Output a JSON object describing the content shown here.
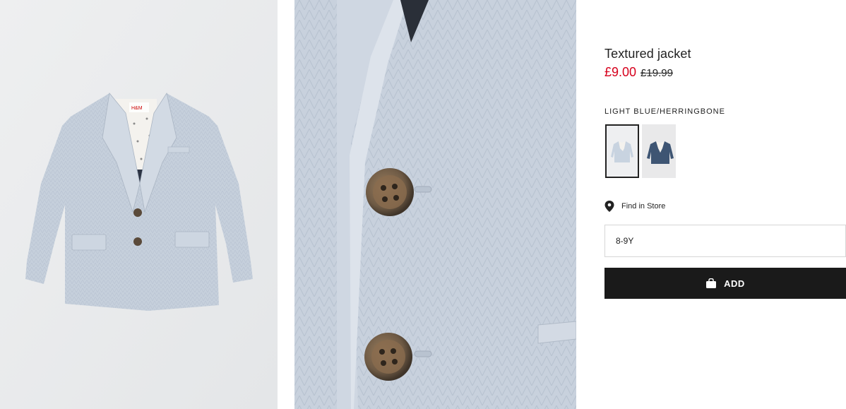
{
  "product": {
    "title": "Textured jacket",
    "price_sale": "£9.00",
    "price_original": "£19.99",
    "color_label": "LIGHT BLUE/HERRINGBONE",
    "sale_color": "#d6001c",
    "swatches": [
      {
        "name": "light-blue-herringbone",
        "color": "#c8d3e0",
        "selected": true
      },
      {
        "name": "dark-blue",
        "color": "#3e5573",
        "selected": false
      }
    ]
  },
  "store": {
    "label": "Find in Store",
    "icon": "location-pin-icon"
  },
  "size": {
    "value": "8-9Y"
  },
  "add_button": {
    "label": "ADD",
    "icon": "shopping-bag-icon"
  },
  "images": {
    "main_bg": "#ebeced",
    "jacket_color": "#c6d0dc",
    "detail_bg": "#c9d1dc",
    "button_color": "#5a4a3a"
  }
}
